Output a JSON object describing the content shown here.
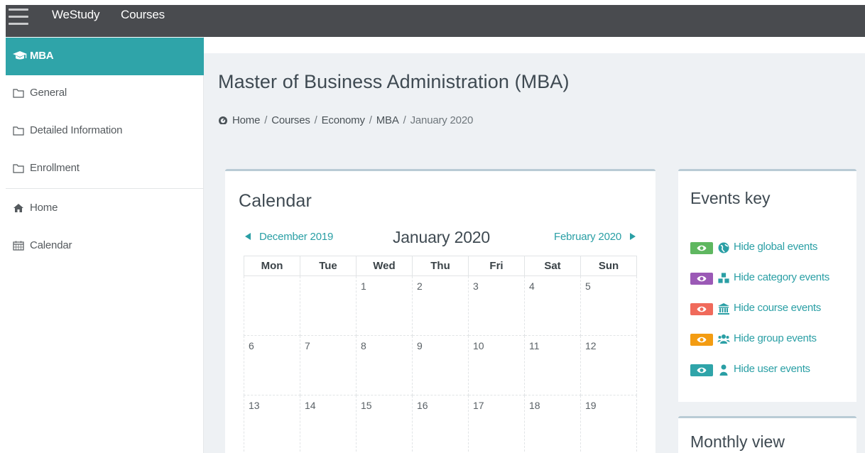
{
  "navbar": {
    "brand": "WeStudy",
    "courses": "Courses",
    "bg_color": "#494b4f"
  },
  "sidebar": {
    "active_item": "MBA",
    "accent_color": "#2fa4a9",
    "items": [
      {
        "label": "General",
        "icon": "folder-icon"
      },
      {
        "label": "Detailed Information",
        "icon": "folder-icon"
      },
      {
        "label": "Enrollment",
        "icon": "folder-icon"
      },
      {
        "label": "Home",
        "icon": "home-icon"
      },
      {
        "label": "Calendar",
        "icon": "calendar-icon"
      }
    ]
  },
  "page": {
    "title": "Master of Business Administration (MBA)",
    "breadcrumb": [
      "Home",
      "Courses",
      "Economy",
      "MBA",
      "January 2020"
    ],
    "breadcrumb_separator": "/"
  },
  "calendar": {
    "title": "Calendar",
    "prev_month": "December 2019",
    "current_month": "January 2020",
    "next_month": "February 2020",
    "weekdays": [
      "Mon",
      "Tue",
      "Wed",
      "Thu",
      "Fri",
      "Sat",
      "Sun"
    ],
    "weeks": [
      [
        "",
        "",
        "1",
        "2",
        "3",
        "4",
        "5"
      ],
      [
        "6",
        "7",
        "8",
        "9",
        "10",
        "11",
        "12"
      ],
      [
        "13",
        "14",
        "15",
        "16",
        "17",
        "18",
        "19"
      ]
    ]
  },
  "events_key": {
    "title": "Events key",
    "items": [
      {
        "label": "Hide global events",
        "color": "#5fb760",
        "icon": "globe-icon"
      },
      {
        "label": "Hide category events",
        "color": "#9b59b6",
        "icon": "cubes-icon"
      },
      {
        "label": "Hide course events",
        "color": "#f06a5b",
        "icon": "university-icon"
      },
      {
        "label": "Hide group events",
        "color": "#f39c12",
        "icon": "users-icon"
      },
      {
        "label": "Hide user events",
        "color": "#2fa4a9",
        "icon": "user-icon"
      }
    ]
  },
  "monthly_view": {
    "title": "Monthly view"
  }
}
